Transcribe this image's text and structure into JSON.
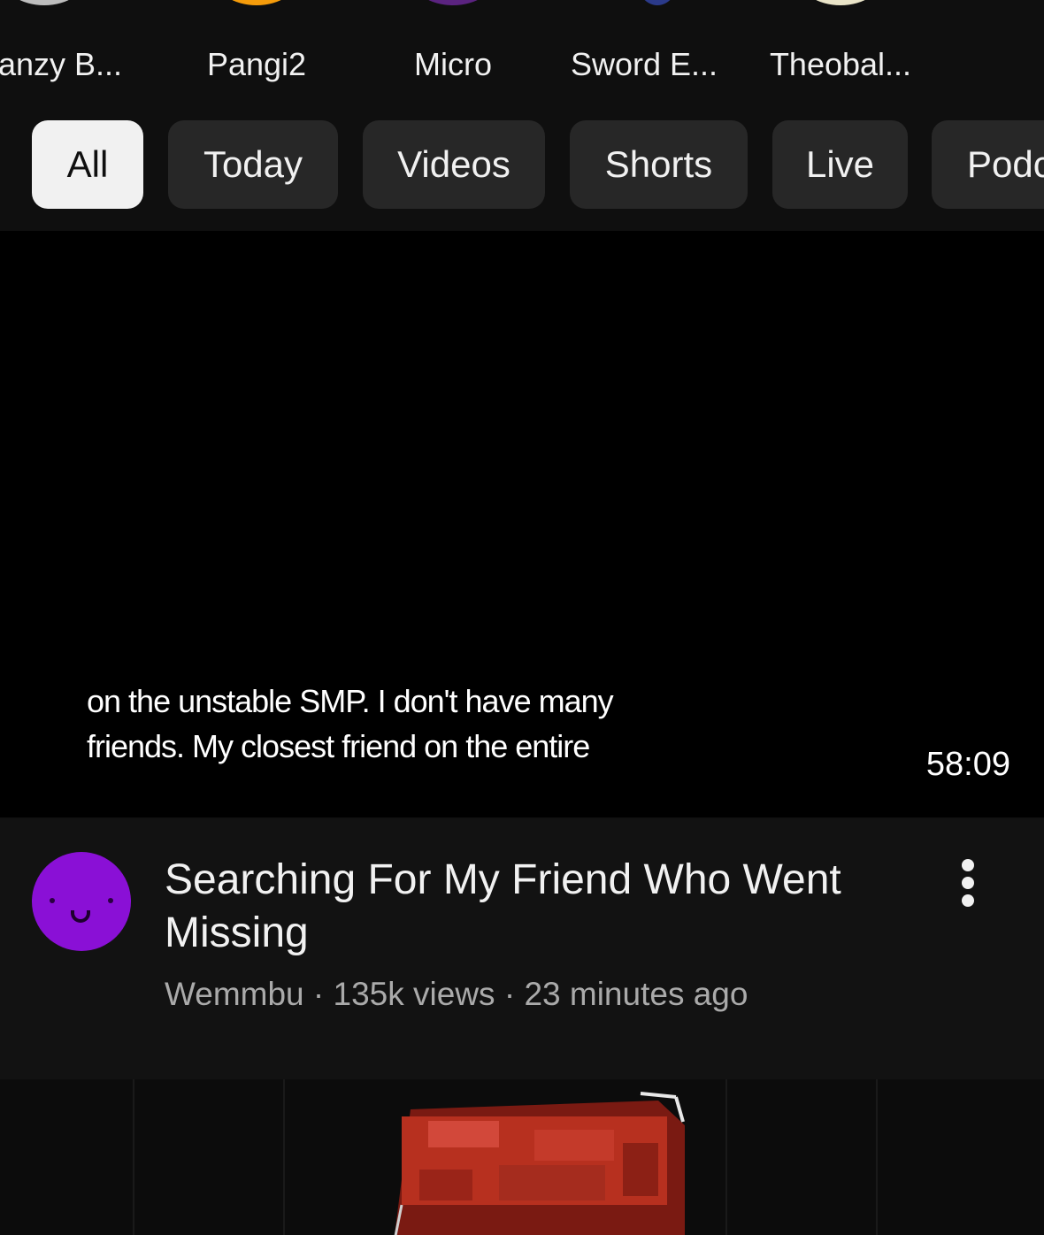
{
  "channels": [
    {
      "name": "Branzy B..."
    },
    {
      "name": "Pangi2"
    },
    {
      "name": "Micro"
    },
    {
      "name": "Sword E..."
    },
    {
      "name": "Theobal..."
    }
  ],
  "chips": [
    "All",
    "Today",
    "Videos",
    "Shorts",
    "Live",
    "Podc"
  ],
  "player": {
    "caption_line1": "on the unstable SMP. I don't have many",
    "caption_line2": "friends. My closest friend on the entire",
    "duration": "58:09"
  },
  "video": {
    "title": "Searching For My Friend Who Went Missing",
    "channel": "Wemmbu",
    "views": "135k views",
    "age": "23 minutes ago",
    "separator": " · "
  },
  "colors": {
    "background": "#0f0f0f",
    "chip_active": "#f1f1f1",
    "chip_inactive": "#272727",
    "channel_avatar": "#8a10d6",
    "secondary_text": "#aaaaaa"
  },
  "icons": [
    "more-vert-icon"
  ]
}
